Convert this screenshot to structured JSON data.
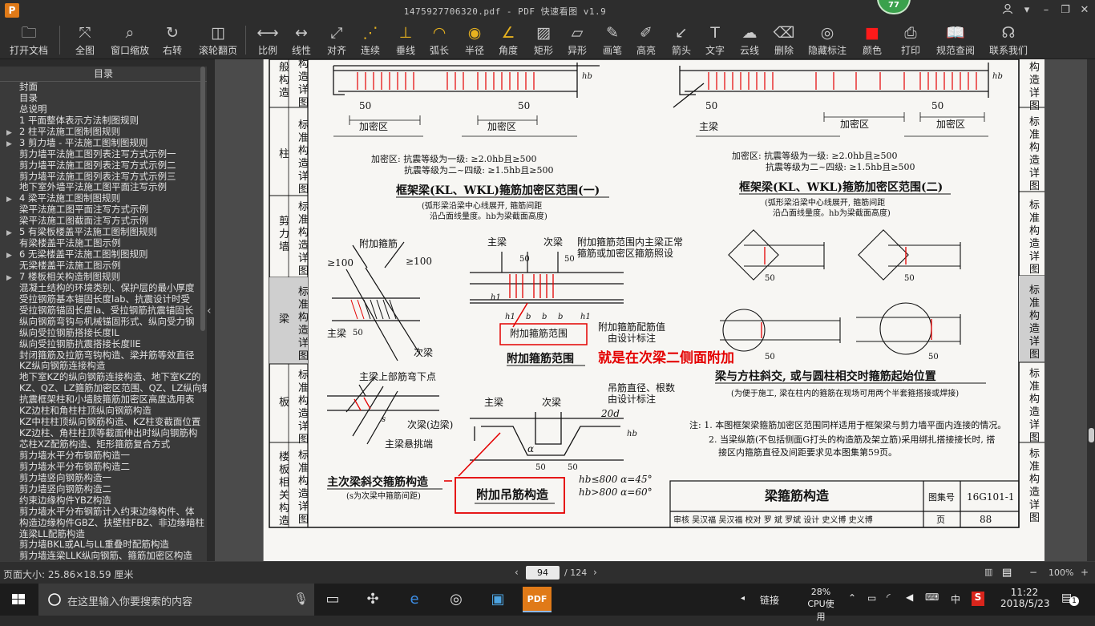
{
  "window": {
    "title": "1475927706320.pdf - PDF 快速看图 v1.9",
    "badge": "77",
    "app_icon": "P"
  },
  "toolbar": [
    {
      "name": "open-file",
      "icon": "folder-icon",
      "label": "打开文档"
    },
    {
      "name": "full-view",
      "icon": "expand-icon",
      "label": "全图"
    },
    {
      "name": "window-zoom",
      "icon": "magnifier-icon",
      "label": "窗口缩放"
    },
    {
      "name": "rotate-right",
      "icon": "rotate-icon",
      "label": "右转"
    },
    {
      "name": "scroll-page",
      "icon": "mouse-icon",
      "label": "滚轮翻页"
    },
    {
      "name": "scale",
      "icon": "ruler-icon",
      "label": "比例"
    },
    {
      "name": "linear",
      "icon": "linear-dimension-icon",
      "label": "线性"
    },
    {
      "name": "align",
      "icon": "aligned-dimension-icon",
      "label": "对齐"
    },
    {
      "name": "continuous",
      "icon": "continuous-dimension-icon",
      "label": "连续"
    },
    {
      "name": "perpendicular",
      "icon": "perpendicular-icon",
      "label": "垂线"
    },
    {
      "name": "arc-length",
      "icon": "arc-icon",
      "label": "弧长"
    },
    {
      "name": "radius",
      "icon": "radius-icon",
      "label": "半径"
    },
    {
      "name": "angle",
      "icon": "angle-icon",
      "label": "角度"
    },
    {
      "name": "rectangle",
      "icon": "rectangle-icon",
      "label": "矩形"
    },
    {
      "name": "polygon",
      "icon": "polygon-icon",
      "label": "异形"
    },
    {
      "name": "pen",
      "icon": "pen-icon",
      "label": "画笔"
    },
    {
      "name": "highlight",
      "icon": "highlighter-icon",
      "label": "高亮"
    },
    {
      "name": "arrow",
      "icon": "arrow-icon",
      "label": "箭头"
    },
    {
      "name": "text",
      "icon": "text-icon",
      "label": "文字"
    },
    {
      "name": "cloud-line",
      "icon": "cloud-icon",
      "label": "云线"
    },
    {
      "name": "delete",
      "icon": "eraser-icon",
      "label": "删除"
    },
    {
      "name": "hide-annotations",
      "icon": "eye-off-icon",
      "label": "隐藏标注"
    },
    {
      "name": "color",
      "icon": "color-swatch-icon",
      "label": "颜色"
    },
    {
      "name": "print",
      "icon": "printer-icon",
      "label": "打印"
    },
    {
      "name": "standards",
      "icon": "book-icon",
      "label": "规范查阅"
    },
    {
      "name": "contact",
      "icon": "headset-icon",
      "label": "联系我们"
    }
  ],
  "sidebar": {
    "title": "目录",
    "items": [
      {
        "label": "封面",
        "caret": ""
      },
      {
        "label": "目录",
        "caret": ""
      },
      {
        "label": "总说明",
        "caret": ""
      },
      {
        "label": "1  平面整体表示方法制图规则",
        "caret": ""
      },
      {
        "label": "2  柱平法施工图制图规则",
        "caret": "▶"
      },
      {
        "label": "3  剪力墙 - 平法施工图制图规则",
        "caret": "▶"
      },
      {
        "label": "剪力墙平法施工图列表注写方式示例一",
        "caret": ""
      },
      {
        "label": "剪力墙平法施工图列表注写方式示例二",
        "caret": ""
      },
      {
        "label": "剪力墙平法施工图列表注写方式示例三",
        "caret": ""
      },
      {
        "label": "地下室外墙平法施工图平面注写示例",
        "caret": ""
      },
      {
        "label": "4  梁平法施工图制图规则",
        "caret": "▶"
      },
      {
        "label": "梁平法施工图平面注写方式示例",
        "caret": ""
      },
      {
        "label": "梁平法施工图截面注写方式示例",
        "caret": ""
      },
      {
        "label": "5  有梁板楼盖平法施工图制图规则",
        "caret": "▶"
      },
      {
        "label": "有梁楼盖平法施工图示例",
        "caret": ""
      },
      {
        "label": "6  无梁楼盖平法施工图制图规则",
        "caret": "▶"
      },
      {
        "label": "无梁楼盖平法施工图示例",
        "caret": ""
      },
      {
        "label": "7  楼板相关构造制图规则",
        "caret": "▶"
      },
      {
        "label": "混凝土结构的环境类别、保护层的最小厚度",
        "caret": ""
      },
      {
        "label": "受拉钢筋基本锚固长度lab、抗震设计时受",
        "caret": ""
      },
      {
        "label": "受拉钢筋锚固长度la、受拉钢筋抗震锚固长",
        "caret": ""
      },
      {
        "label": "纵向钢筋弯钩与机械锚固形式、纵向受力钢",
        "caret": ""
      },
      {
        "label": "纵向受拉钢筋搭接长度lL",
        "caret": ""
      },
      {
        "label": "纵向受拉钢筋抗震搭接长度llE",
        "caret": ""
      },
      {
        "label": "封闭箍筋及拉筋弯钩构造、梁并筋等效直径",
        "caret": ""
      },
      {
        "label": "KZ纵向钢筋连接构造",
        "caret": ""
      },
      {
        "label": "地下室KZ的纵向钢筋连接构造、地下室KZ的",
        "caret": ""
      },
      {
        "label": "KZ、QZ、LZ箍筋加密区范围、QZ、LZ纵向钢",
        "caret": ""
      },
      {
        "label": "抗震框架柱和小墙肢箍筋加密区高度选用表",
        "caret": ""
      },
      {
        "label": "KZ边柱和角柱柱顶纵向钢筋构造",
        "caret": ""
      },
      {
        "label": "KZ中柱柱顶纵向钢筋构造、KZ柱变截面位置",
        "caret": ""
      },
      {
        "label": "KZ边柱、角柱柱顶等截面伸出时纵向钢筋构",
        "caret": ""
      },
      {
        "label": "芯柱XZ配筋构造、矩形箍筋复合方式",
        "caret": ""
      },
      {
        "label": "剪力墙水平分布钢筋构造一",
        "caret": ""
      },
      {
        "label": "剪力墙水平分布钢筋构造二",
        "caret": ""
      },
      {
        "label": "剪力墙竖向钢筋构造一",
        "caret": ""
      },
      {
        "label": "剪力墙竖向钢筋构造二",
        "caret": ""
      },
      {
        "label": "约束边缘构件YBZ构造",
        "caret": ""
      },
      {
        "label": "剪力墙水平分布钢筋计入约束边缘构件、体",
        "caret": ""
      },
      {
        "label": "构造边缘构件GBZ、扶壁柱FBZ、非边缘暗柱",
        "caret": ""
      },
      {
        "label": "连梁LL配筋构造",
        "caret": ""
      },
      {
        "label": "剪力墙BKL或AL与LL重叠时配筋构造",
        "caret": ""
      },
      {
        "label": "剪力墙连梁LLK纵向钢筋、箍筋加密区构造",
        "caret": ""
      }
    ]
  },
  "page": {
    "side_tabs_left": [
      "梁构造详图",
      "柱",
      "标准构造详图",
      "剪力墙",
      "标准构造详图",
      "梁",
      "标准构造详图",
      "板",
      "标准构造详图",
      "楼板相关构造",
      "标准构造详图"
    ],
    "side_tabs_right": [
      "构造详图",
      "标准构造详图",
      "标准构造详图",
      "标准构造详图",
      "标准构造详图",
      "标准构造详图"
    ],
    "texts": {
      "dense_zone": "加密区",
      "dim_50": "50",
      "hb": "hb",
      "main_beam": "主梁",
      "dense_note_1": "加密区: 抗震等级为一级: ≥2.0hb且≥500",
      "dense_note_2": "抗震等级为二~四级: ≥1.5hb且≥500",
      "title_kl_1": "框架梁(KL、WKL)箍筋加密区范围(一)",
      "title_kl_2": "框架梁(KL、WKL)箍筋加密区范围(二)",
      "sub_kl_1a": "(弧形梁沿梁中心线展开, 箍筋间距",
      "sub_kl_1b": "沿凸面线量度。hb为梁截面高度)",
      "extra_stirrup": "附加箍筋",
      "ge100": "≥100",
      "secondary_beam": "次梁",
      "main_stirrup_note_1": "附加箍筋范围内主梁正常",
      "main_stirrup_note_2": "箍筋或加密区箍筋照设",
      "extra_stirrup_range": "附加箍筋范围",
      "extra_stirrup_rebar_1": "附加箍筋配筋值",
      "extra_stirrup_rebar_2": "由设计标注",
      "annotation_red": "就是在次梁二侧面附加",
      "beam_column_title": "梁与方柱斜交, 或与圆柱相交时箍筋起始位置",
      "beam_column_sub": "(为便于施工, 梁在柱内的箍筋在现场可用两个半套箍搭接或焊接)",
      "main_top_bar": "主梁上部筋弯下点",
      "sec_edge": "次梁(边梁)",
      "main_cantilever": "主梁悬挑端",
      "hanger_dia_1": "吊筋直径、根数",
      "hanger_dia_2": "由设计标注",
      "twenty_d": "20d",
      "alpha": "α",
      "skew_title": "主次梁斜交箍筋构造",
      "skew_sub": "(s为次梁中箍筋间距)",
      "hanger_title": "附加吊筋构造",
      "hb_800_1": "hb≤800  α=45°",
      "hb_800_2": "hb>800  α=60°",
      "note_1": "注: 1. 本图框架梁箍筋加密区范围同样适用于框架梁与剪力墙平面内连接的情况。",
      "note_2": "2. 当梁纵筋(不包括侧面G打头的构造筋及架立筋)采用绑扎搭接接长时, 搭",
      "note_3": "接区内箍筋直径及间距要求见本图集第59页。",
      "sheet_title": "梁箍筋构造",
      "atlas_label": "图集号",
      "atlas_no": "16G101-1",
      "sign_row": "审核 吴汉福  吴汉福 校对 罗  斌  罗斌 设计 史义博  史义博",
      "page_label": "页",
      "page_no": "88",
      "b": "b",
      "h1": "h1",
      "s": "s"
    }
  },
  "statusbar": {
    "page_size": "页面大小: 25.86×18.59 厘米",
    "current_page": "94",
    "total": "/ 124",
    "zoom": "100%"
  },
  "taskbar": {
    "search_placeholder": "在这里输入你要搜索的内容",
    "link": "链接",
    "cpu_pct": "28%",
    "cpu_label": "CPU使用",
    "ime": "中",
    "time": "11:22",
    "date": "2018/5/23",
    "notif_count": "1"
  },
  "colors": {
    "annotation_red": "#e40000",
    "toolbar_bg": "#2d2d2d",
    "sidebar_bg": "#3a3a3a",
    "accent_yellow": "#e7b21f",
    "badge_green": "#3aa14c"
  }
}
